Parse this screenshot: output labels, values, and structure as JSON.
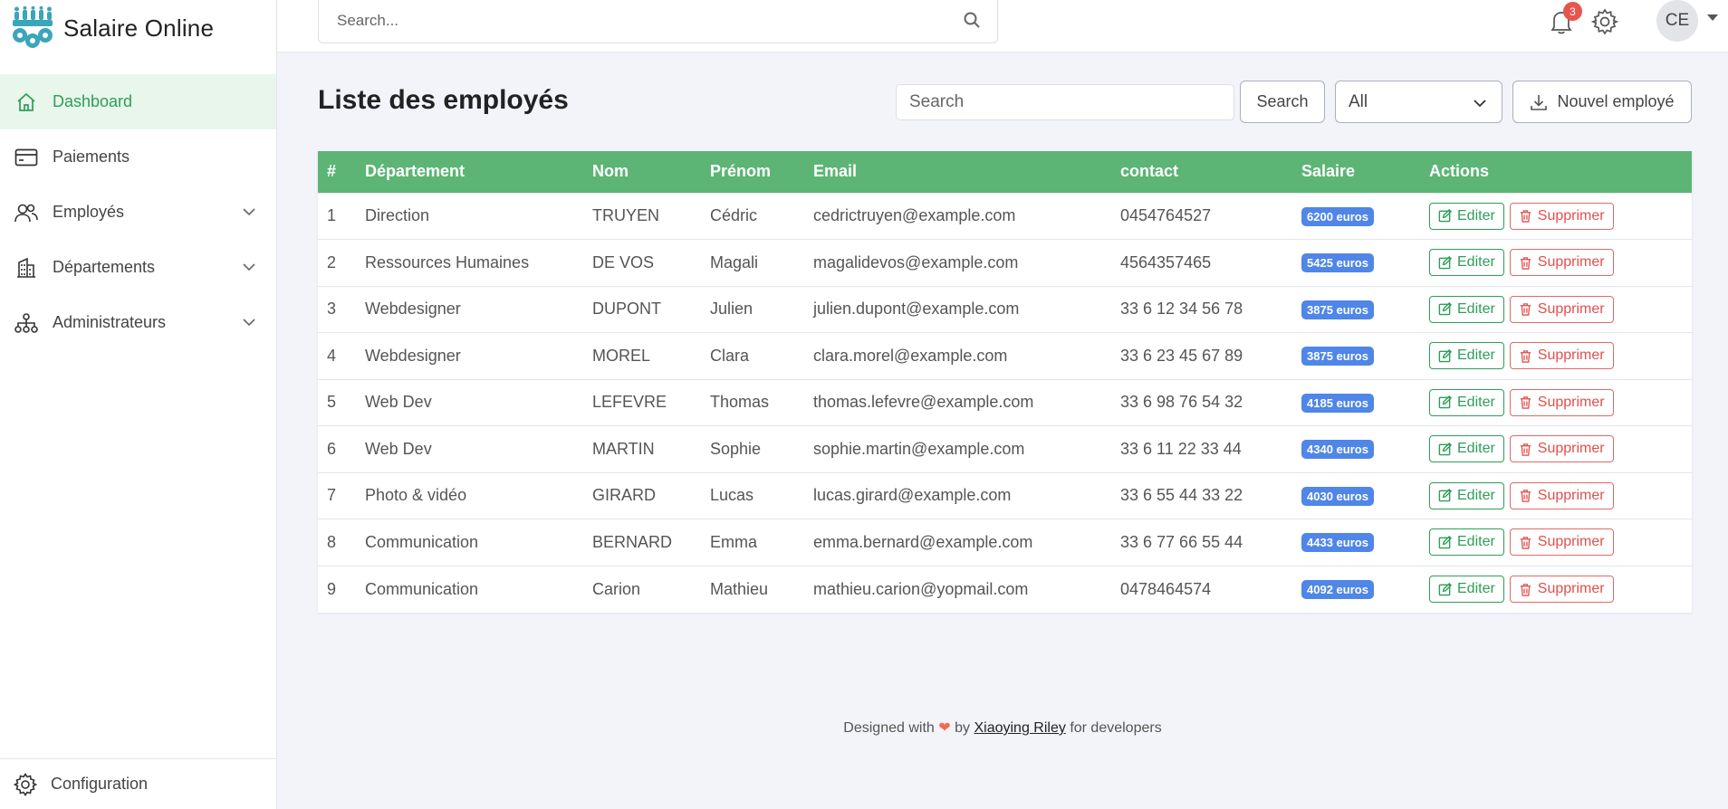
{
  "brand": {
    "name": "Salaire Online"
  },
  "sidebar": {
    "items": [
      {
        "label": "Dashboard",
        "icon": "home-icon",
        "active": true,
        "expandable": false
      },
      {
        "label": "Paiements",
        "icon": "card-icon",
        "active": false,
        "expandable": false
      },
      {
        "label": "Employés",
        "icon": "users-icon",
        "active": false,
        "expandable": true
      },
      {
        "label": "Départements",
        "icon": "building-icon",
        "active": false,
        "expandable": true
      },
      {
        "label": "Administrateurs",
        "icon": "org-chart-icon",
        "active": false,
        "expandable": true
      }
    ],
    "bottom": {
      "label": "Configuration",
      "icon": "gear-icon"
    }
  },
  "topbar": {
    "search_placeholder": "Search...",
    "notifications_count": "3",
    "avatar_initials": "CE"
  },
  "main": {
    "title": "Liste des employés",
    "filter_placeholder": "Search",
    "search_button": "Search",
    "department_filter": "All",
    "new_button": "Nouvel employé"
  },
  "table": {
    "columns": [
      "#",
      "Département",
      "Nom",
      "Prénom",
      "Email",
      "contact",
      "Salaire",
      "Actions"
    ],
    "edit_label": "Editer",
    "delete_label": "Supprimer",
    "rows": [
      {
        "id": "1",
        "dept": "Direction",
        "nom": "TRUYEN",
        "prenom": "Cédric",
        "email": "cedrictruyen@example.com",
        "contact": "0454764527",
        "salaire": "6200 euros"
      },
      {
        "id": "2",
        "dept": "Ressources Humaines",
        "nom": "DE VOS",
        "prenom": "Magali",
        "email": "magalidevos@example.com",
        "contact": "4564357465",
        "salaire": "5425 euros"
      },
      {
        "id": "3",
        "dept": "Webdesigner",
        "nom": "DUPONT",
        "prenom": "Julien",
        "email": "julien.dupont@example.com",
        "contact": "33 6 12 34 56 78",
        "salaire": "3875 euros"
      },
      {
        "id": "4",
        "dept": "Webdesigner",
        "nom": "MOREL",
        "prenom": "Clara",
        "email": "clara.morel@example.com",
        "contact": "33 6 23 45 67 89",
        "salaire": "3875 euros"
      },
      {
        "id": "5",
        "dept": "Web Dev",
        "nom": "LEFEVRE",
        "prenom": "Thomas",
        "email": "thomas.lefevre@example.com",
        "contact": "33 6 98 76 54 32",
        "salaire": "4185 euros"
      },
      {
        "id": "6",
        "dept": "Web Dev",
        "nom": "MARTIN",
        "prenom": "Sophie",
        "email": "sophie.martin@example.com",
        "contact": "33 6 11 22 33 44",
        "salaire": "4340 euros"
      },
      {
        "id": "7",
        "dept": "Photo & vidéo",
        "nom": "GIRARD",
        "prenom": "Lucas",
        "email": "lucas.girard@example.com",
        "contact": "33 6 55 44 33 22",
        "salaire": "4030 euros"
      },
      {
        "id": "8",
        "dept": "Communication",
        "nom": "BERNARD",
        "prenom": "Emma",
        "email": "emma.bernard@example.com",
        "contact": "33 6 77 66 55 44",
        "salaire": "4433 euros"
      },
      {
        "id": "9",
        "dept": "Communication",
        "nom": "Carion",
        "prenom": "Mathieu",
        "email": "mathieu.carion@yopmail.com",
        "contact": "0478464574",
        "salaire": "4092 euros"
      }
    ]
  },
  "footer": {
    "prefix": "Designed with",
    "by": "by",
    "author": "Xiaoying Riley",
    "suffix": "for developers"
  },
  "colors": {
    "accent": "#2e9e57",
    "table_header": "#5cb574",
    "badge": "#4f86e8",
    "danger": "#e0504d",
    "notification": "#e8554e"
  }
}
